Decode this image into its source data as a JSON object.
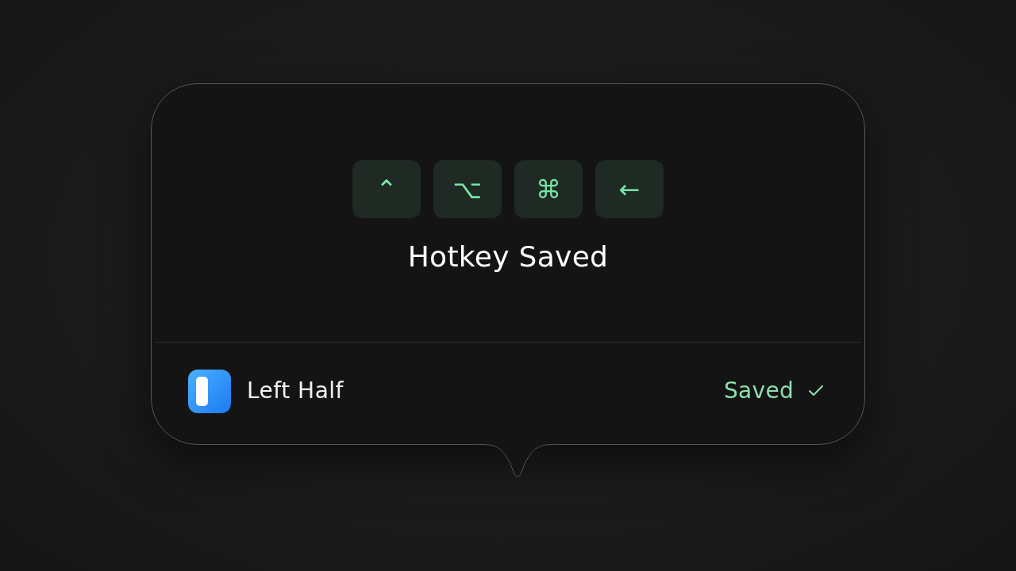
{
  "keys": [
    {
      "symbol": "⌃"
    },
    {
      "symbol": "⌥"
    },
    {
      "symbol": "⌘"
    },
    {
      "symbol": "←"
    }
  ],
  "title": "Hotkey Saved",
  "action": {
    "label": "Left Half",
    "status": "Saved"
  }
}
